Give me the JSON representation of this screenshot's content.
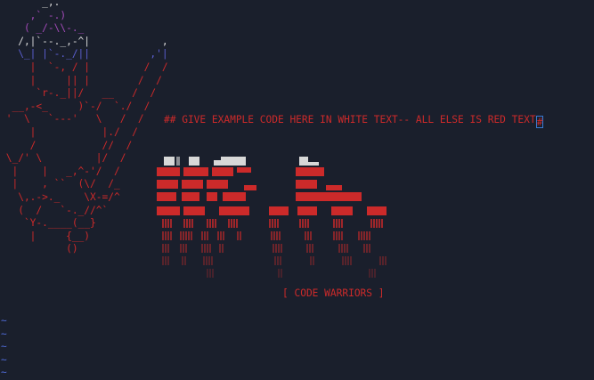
{
  "editor": {
    "comment_text": "## GIVE EXAMPLE CODE HERE IN WHITE TEXT-- ALL ELSE IS RED TEXT",
    "cursor_char": "#",
    "subtitle": "[ CODE WARRIORS ]",
    "empty_line_marker": "~",
    "empty_lines": [
      "~",
      "~",
      "~",
      "~",
      "~"
    ]
  },
  "colors": {
    "background": "#1a1f2c",
    "text_red": "#cc2a2a",
    "text_purple": "#a24ab8",
    "text_blue": "#5b5fd0",
    "cursor_blue": "#3a7bd5",
    "tilde_blue": "#4f6bd8",
    "logo_white": "#d8d8d8"
  },
  "ascii_figure": {
    "lines": [
      "       _,.",
      "     ,` -.)",
      "    ( _/-\\\\-._",
      "   /,|`--._,-^|            ,",
      "   \\_| |`-._/||          ,'|",
      "     |  `-, / |         /  /",
      "     |     || |        /  /",
      "      `r-._||/   __   /  /",
      "  __,-<_     )`-/  `./  /",
      " '  \\   `---'   \\   /  /",
      "     |           |./  /",
      "     /           //  /",
      " \\_/' \\         |/  /",
      "  |    |   _,^-'/  /",
      "  |    , ``  (\\/  /_",
      "   \\,.->._    \\X-=/^",
      "   (  /   `-._//^`",
      "    `Y-.____(__}",
      "     |     {__)",
      "           ()"
    ]
  }
}
